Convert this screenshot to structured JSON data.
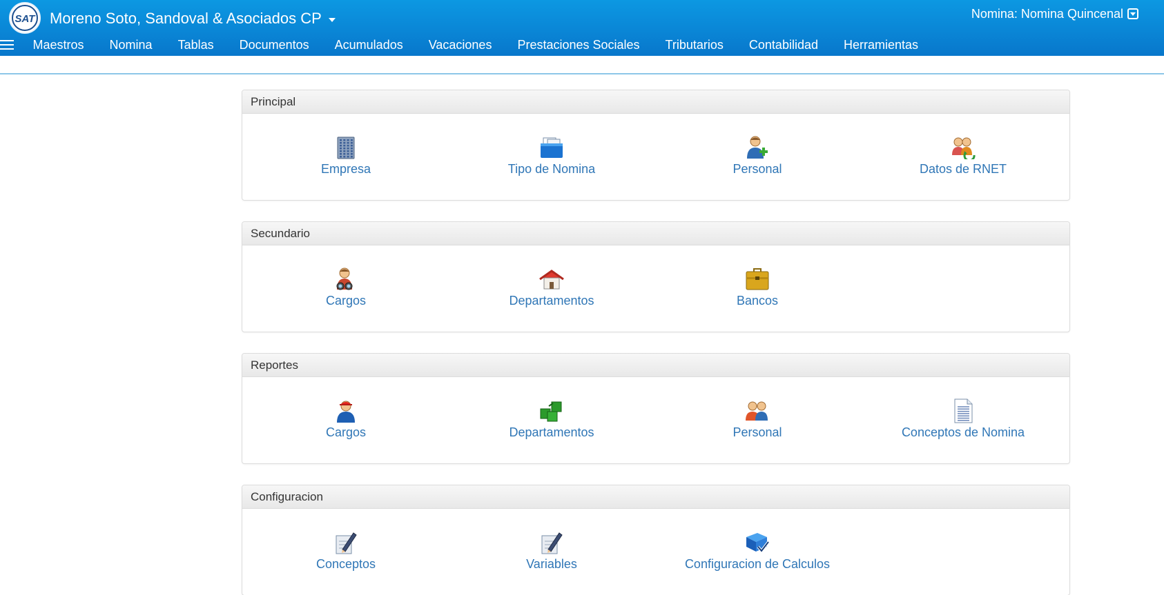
{
  "header": {
    "logo_text": "SAT",
    "company": "Moreno Soto, Sandoval & Asociados CP",
    "nomina_selector": "Nomina: Nomina Quincenal"
  },
  "nav": [
    "Maestros",
    "Nomina",
    "Tablas",
    "Documentos",
    "Acumulados",
    "Vacaciones",
    "Prestaciones Sociales",
    "Tributarios",
    "Contabilidad",
    "Herramientas"
  ],
  "panels": [
    {
      "title": "Principal",
      "items": [
        {
          "label": "Empresa",
          "icon": "building-icon"
        },
        {
          "label": "Tipo de Nomina",
          "icon": "folder-icon"
        },
        {
          "label": "Personal",
          "icon": "user-add-icon"
        },
        {
          "label": "Datos de RNET",
          "icon": "users-sync-icon"
        }
      ]
    },
    {
      "title": "Secundario",
      "items": [
        {
          "label": "Cargos",
          "icon": "user-binoculars-icon"
        },
        {
          "label": "Departamentos",
          "icon": "house-icon"
        },
        {
          "label": "Bancos",
          "icon": "briefcase-icon"
        }
      ]
    },
    {
      "title": "Reportes",
      "items": [
        {
          "label": "Cargos",
          "icon": "worker-icon"
        },
        {
          "label": "Departamentos",
          "icon": "green-boxes-icon"
        },
        {
          "label": "Personal",
          "icon": "users-icon"
        },
        {
          "label": "Conceptos de Nomina",
          "icon": "document-icon"
        }
      ]
    },
    {
      "title": "Configuracion",
      "items": [
        {
          "label": "Conceptos",
          "icon": "pen-paper-icon"
        },
        {
          "label": "Variables",
          "icon": "pen-paper-icon"
        },
        {
          "label": "Configuracion de Calculos",
          "icon": "book-check-icon"
        }
      ]
    }
  ]
}
